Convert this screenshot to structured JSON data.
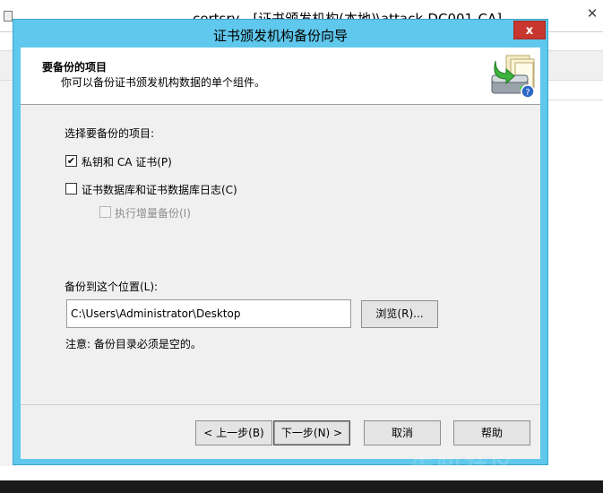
{
  "background_window": {
    "title": "certsrv - [证书颁发机构(本地)\\attack-DC001-CA]",
    "close_label": "✕"
  },
  "dialog": {
    "title": "证书颁发机构备份向导",
    "close_label": "x",
    "header": {
      "title": "要备份的项目",
      "subtitle": "你可以备份证书颁发机构数据的单个组件。",
      "icon": "backup-wizard-icon"
    },
    "items_label": "选择要备份的项目:",
    "options": [
      {
        "label": "私钥和 CA 证书(P)",
        "checked": true,
        "enabled": true
      },
      {
        "label": "证书数据库和证书数据库日志(C)",
        "checked": false,
        "enabled": true
      },
      {
        "label": "执行增量备份(I)",
        "checked": false,
        "enabled": false
      }
    ],
    "location_label": "备份到这个位置(L):",
    "location_value": "C:\\Users\\Administrator\\Desktop",
    "browse_label": "浏览(R)...",
    "note": "注意: 备份目录必须是空的。",
    "buttons": {
      "back": "< 上一步(B)",
      "next": "下一步(N) >",
      "cancel": "取消",
      "help": "帮助"
    }
  },
  "watermark": "先知社区",
  "colors": {
    "dialog_frame": "#5fc8ec",
    "close_button": "#c7372f",
    "client_bg": "#f0f0f0"
  }
}
